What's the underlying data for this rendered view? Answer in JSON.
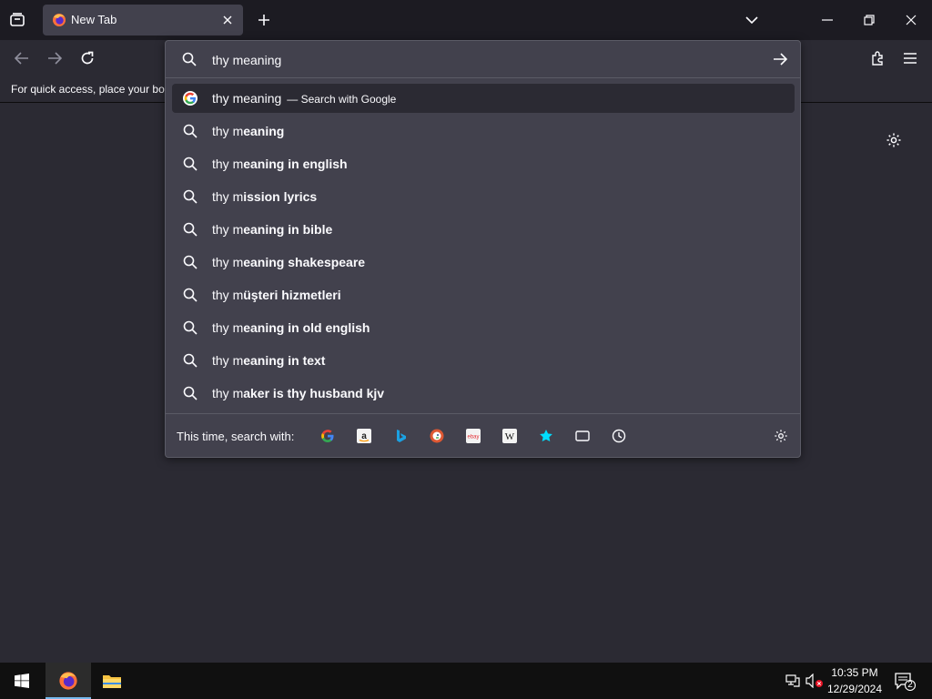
{
  "tab": {
    "title": "New Tab"
  },
  "bookmarks_bar": {
    "text": "For quick access, place your boo"
  },
  "urlbar": {
    "value": "thy meaning",
    "suggestions": [
      {
        "plain": "thy meaning",
        "bold": "",
        "action": "— Search with Google",
        "selected": true,
        "icon": "google-icon"
      },
      {
        "plain": "thy m",
        "bold": "eaning",
        "action": "",
        "selected": false,
        "icon": "search-icon"
      },
      {
        "plain": "thy m",
        "bold": "eaning in english",
        "action": "",
        "selected": false,
        "icon": "search-icon"
      },
      {
        "plain": "thy m",
        "bold": "ission lyrics",
        "action": "",
        "selected": false,
        "icon": "search-icon"
      },
      {
        "plain": "thy m",
        "bold": "eaning in bible",
        "action": "",
        "selected": false,
        "icon": "search-icon"
      },
      {
        "plain": "thy m",
        "bold": "eaning shakespeare",
        "action": "",
        "selected": false,
        "icon": "search-icon"
      },
      {
        "plain": "thy m",
        "bold": "üşteri hizmetleri",
        "action": "",
        "selected": false,
        "icon": "search-icon"
      },
      {
        "plain": "thy m",
        "bold": "eaning in old english",
        "action": "",
        "selected": false,
        "icon": "search-icon"
      },
      {
        "plain": "thy m",
        "bold": "eaning in text",
        "action": "",
        "selected": false,
        "icon": "search-icon"
      },
      {
        "plain": "thy m",
        "bold": "aker is thy husband kjv",
        "action": "",
        "selected": false,
        "icon": "search-icon"
      }
    ],
    "one_off_label": "This time, search with:",
    "engines": [
      "google-icon",
      "amazon-icon",
      "bing-icon",
      "duckduckgo-icon",
      "ebay-icon",
      "wikipedia-icon",
      "bookmarks-star-icon",
      "tabs-icon",
      "history-icon"
    ]
  },
  "taskbar": {
    "time": "10:35 PM",
    "date": "12/29/2024",
    "notification_count": "2"
  },
  "colors": {
    "accent": "#00ddff",
    "tabstrip": "#1c1b22",
    "toolbar": "#2b2a33",
    "panel": "#42414d"
  }
}
